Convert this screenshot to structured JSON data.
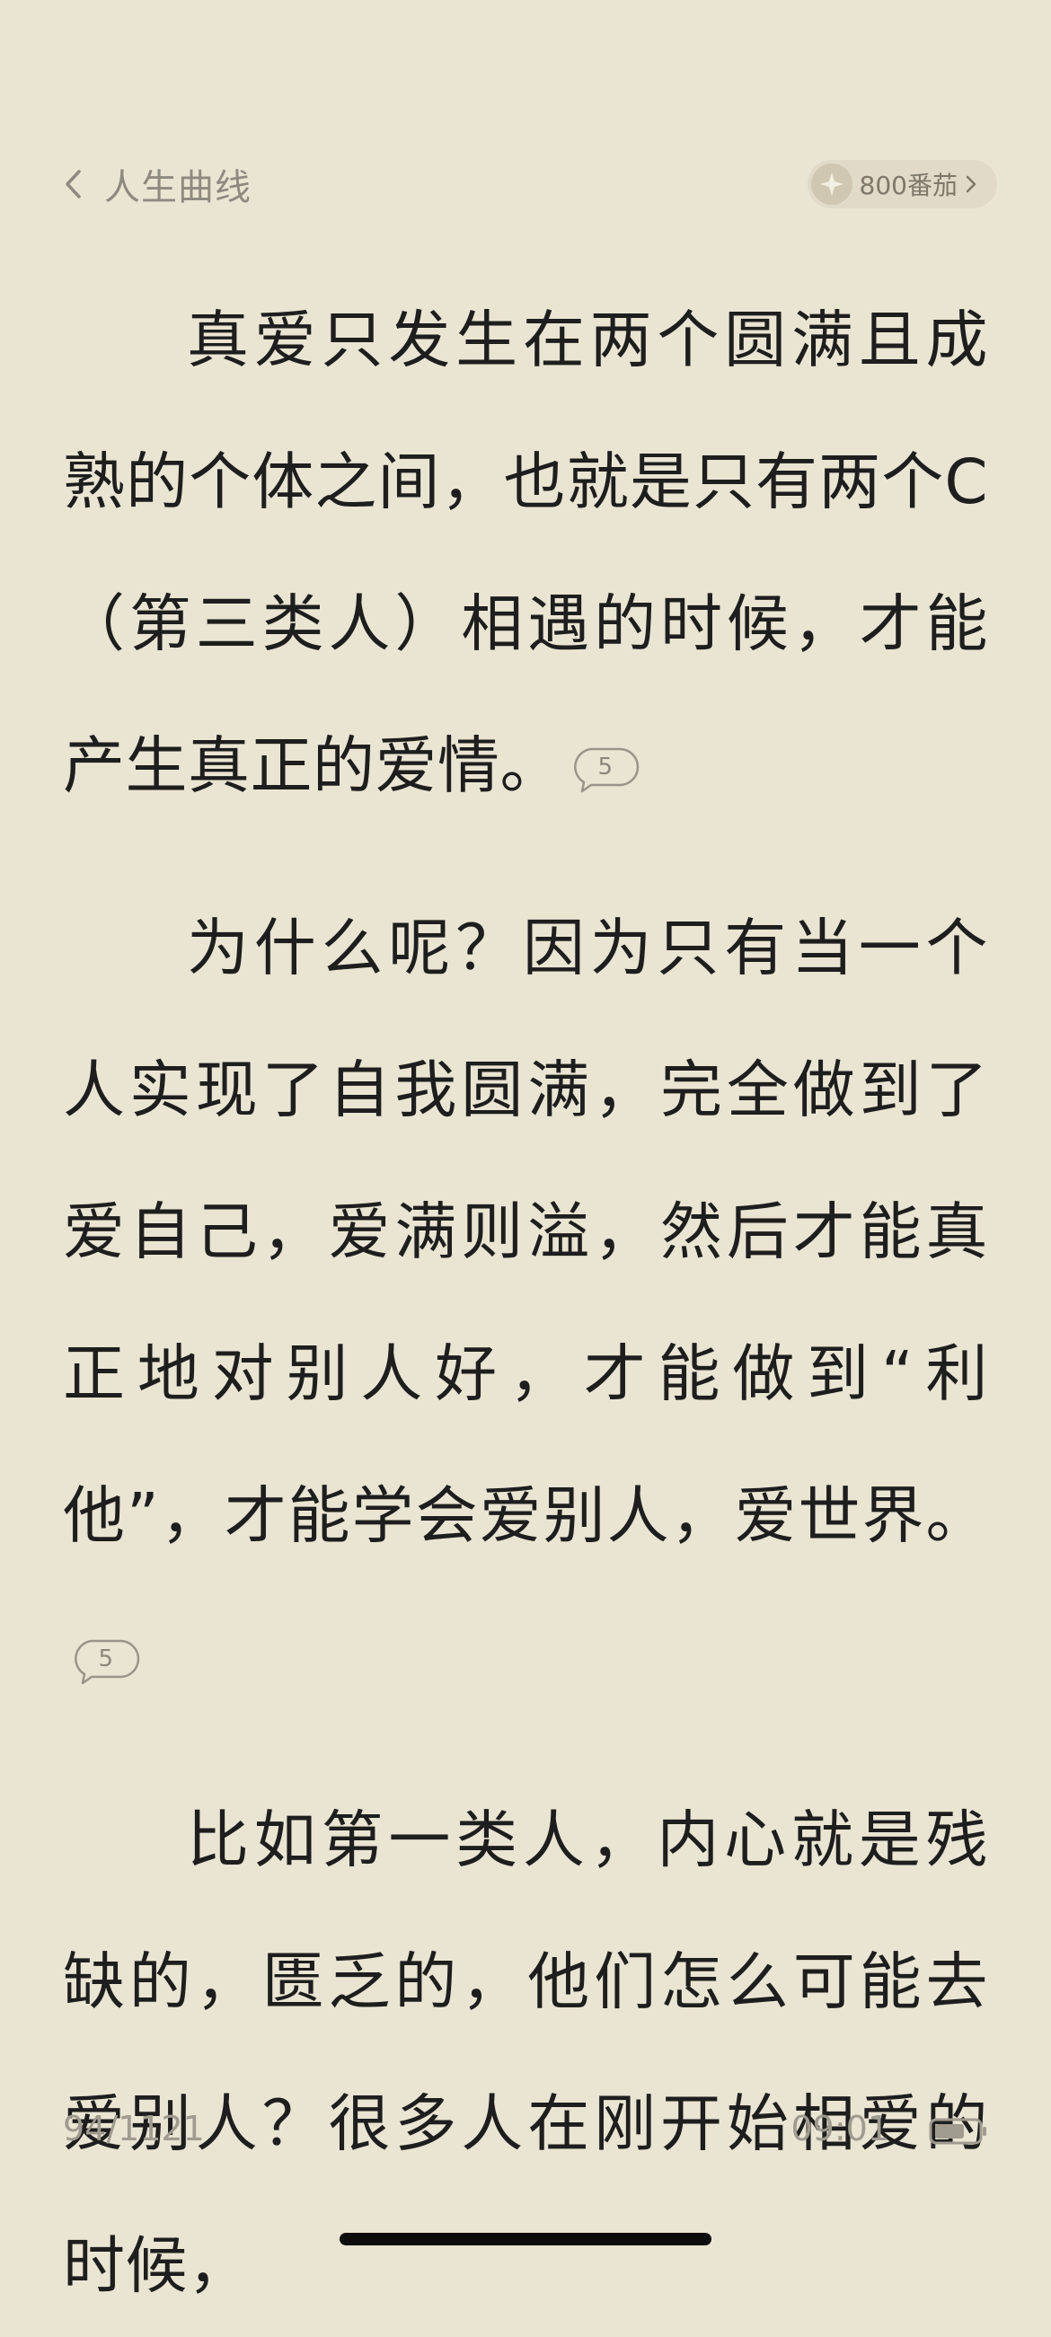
{
  "header": {
    "book_title": "人生曲线",
    "coins_label": "800番茄"
  },
  "paragraphs": [
    {
      "text": "真爱只发生在两个圆满且成熟的个体之间，也就是只有两个C（第三类人）相遇的时候，才能产生真正的爱情。",
      "comment_count": "5"
    },
    {
      "text": "为什么呢？因为只有当一个人实现了自我圆满，完全做到了爱自己，爱满则溢，然后才能真正地对别人好，才能做到“利他”，才能学会爱别人，爱世界。",
      "comment_count": "5"
    },
    {
      "text": "比如第一类人，内心就是残缺的，匮乏的，他们怎么可能去爱别人？很多人在刚开始相爱的时候，"
    }
  ],
  "footer": {
    "page_progress": "94/1121",
    "time": "09:01",
    "battery_level": 0.7
  },
  "colors": {
    "background": "#EAE4D3",
    "text": "#1E1E1E",
    "muted": "#8E8A80"
  }
}
